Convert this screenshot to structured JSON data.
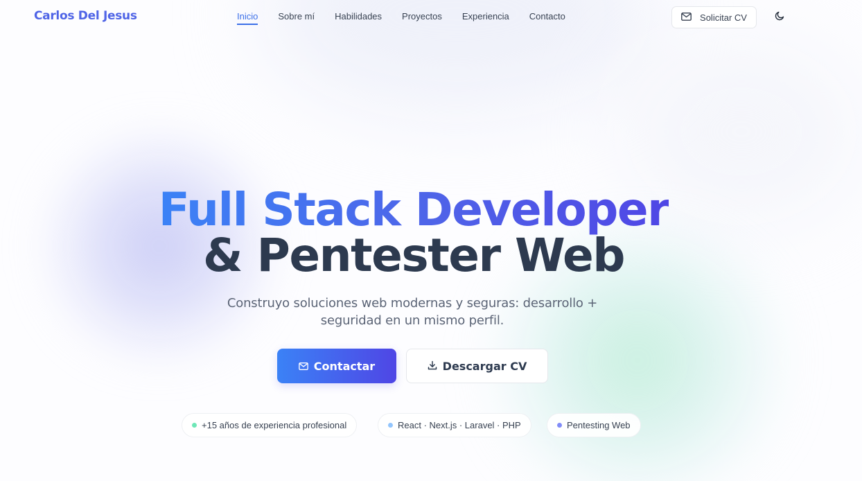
{
  "header": {
    "brand": "Carlos Del Jesus",
    "nav": [
      {
        "label": "Inicio",
        "active": true
      },
      {
        "label": "Sobre mí"
      },
      {
        "label": "Habilidades"
      },
      {
        "label": "Proyectos"
      },
      {
        "label": "Experiencia"
      },
      {
        "label": "Contacto"
      }
    ],
    "cv_button": {
      "label": "Solicitar CV",
      "icon": "mail-icon"
    },
    "theme_toggle": {
      "icon": "moon-icon"
    }
  },
  "hero": {
    "title_line1": "Full Stack Developer",
    "title_line2": "& Pentester Web",
    "subtitle_line1": "Construyo soluciones web modernas y seguras: desarrollo +",
    "subtitle_line2": "seguridad en un mismo perfil.",
    "primary_button": {
      "label": "Contactar",
      "icon": "mail-icon"
    },
    "secondary_button": {
      "label": "Descargar CV",
      "icon": "download-icon"
    },
    "badges": [
      {
        "label": "+15 años de experiencia profesional",
        "dot_color": "#6ee7b7"
      },
      {
        "label": "React · Next.js · Laravel · PHP",
        "dot_color": "#93c5fd"
      },
      {
        "label": "Pentesting Web",
        "dot_color": "#818cf8"
      }
    ]
  },
  "colors": {
    "accent": "#3b82f6",
    "accent_end": "#4f46e5",
    "brand": "#4f64e6",
    "text_dark": "#2d3a4f"
  }
}
